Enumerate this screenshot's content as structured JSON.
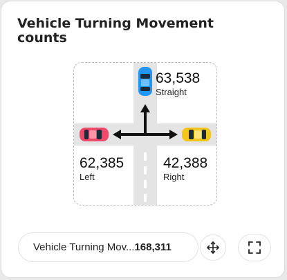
{
  "widget": {
    "title": "Vehicle Turning Movement counts"
  },
  "movements": {
    "straight": {
      "value": "63,538",
      "label": "Straight",
      "car_color": "#2196f3"
    },
    "left": {
      "value": "62,385",
      "label": "Left",
      "car_color": "#f0496b"
    },
    "right": {
      "value": "42,388",
      "label": "Right",
      "car_color": "#f5c518"
    }
  },
  "footer": {
    "summary_label": "Vehicle Turning Mov...",
    "summary_value": "168,311",
    "move_icon": "move-icon",
    "expand_icon": "fullscreen-icon"
  }
}
